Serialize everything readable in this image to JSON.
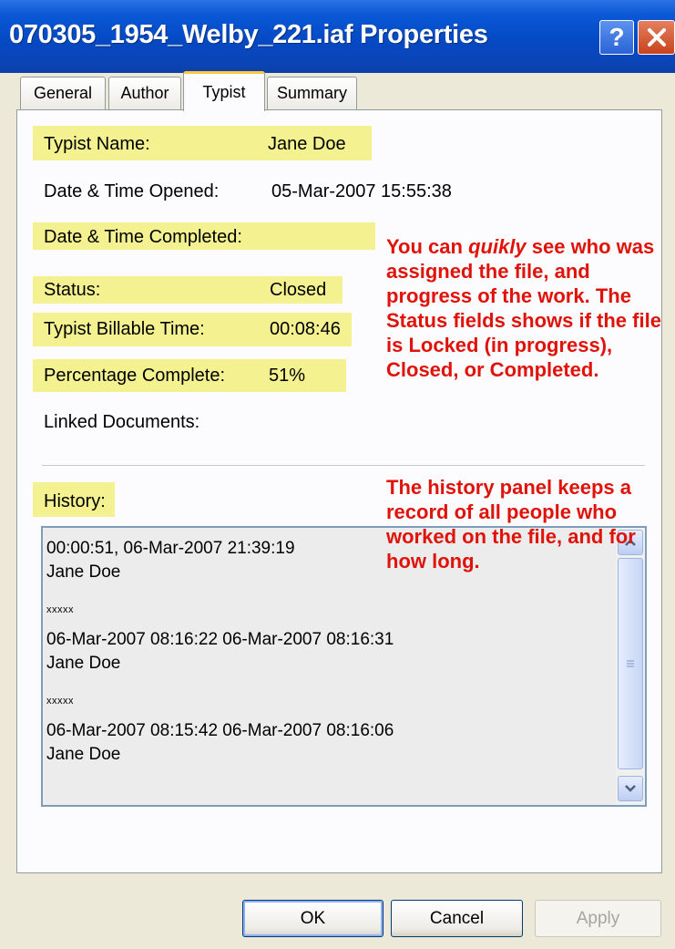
{
  "window": {
    "title": "070305_1954_Welby_221.iaf Properties",
    "help_label": "?"
  },
  "tabs": [
    {
      "label": "General"
    },
    {
      "label": "Author"
    },
    {
      "label": "Typist"
    },
    {
      "label": "Summary"
    }
  ],
  "fields": {
    "typist_name": {
      "label": "Typist Name:",
      "value": "Jane Doe"
    },
    "opened": {
      "label": "Date & Time Opened:",
      "value": "05-Mar-2007 15:55:38"
    },
    "completed": {
      "label": "Date & Time Completed:",
      "value": ""
    },
    "status": {
      "label": "Status:",
      "value": "Closed"
    },
    "billable": {
      "label": "Typist Billable Time:",
      "value": "00:08:46"
    },
    "percent": {
      "label": "Percentage Complete:",
      "value": "51%"
    },
    "linked": {
      "label": "Linked Documents:",
      "value": ""
    }
  },
  "history": {
    "label": "History:",
    "entries": [
      {
        "line1": "00:00:51, 06-Mar-2007 21:39:19",
        "line2": "Jane Doe",
        "sep": "xxxxx"
      },
      {
        "line1": "06-Mar-2007 08:16:22 06-Mar-2007 08:16:31",
        "line2": "Jane Doe",
        "sep": "xxxxx"
      },
      {
        "line1": "06-Mar-2007 08:15:42 06-Mar-2007 08:16:06",
        "line2": "Jane Doe",
        "sep": ""
      }
    ]
  },
  "annotations": {
    "note1": {
      "pre": "You can ",
      "em": "quikly",
      "post": " see who was assigned the file, and progress of the work. The Status fields shows if the file is Locked (in progress), Closed, or Completed."
    },
    "note2": "The history panel keeps a record of all people who worked on the file, and for how long."
  },
  "buttons": {
    "ok": "OK",
    "cancel": "Cancel",
    "apply": "Apply"
  },
  "colors": {
    "highlight": "#f3f190",
    "annotation": "#e0130a",
    "titlebar": "#0549c4",
    "active_tab_accent": "#ffc83c"
  }
}
